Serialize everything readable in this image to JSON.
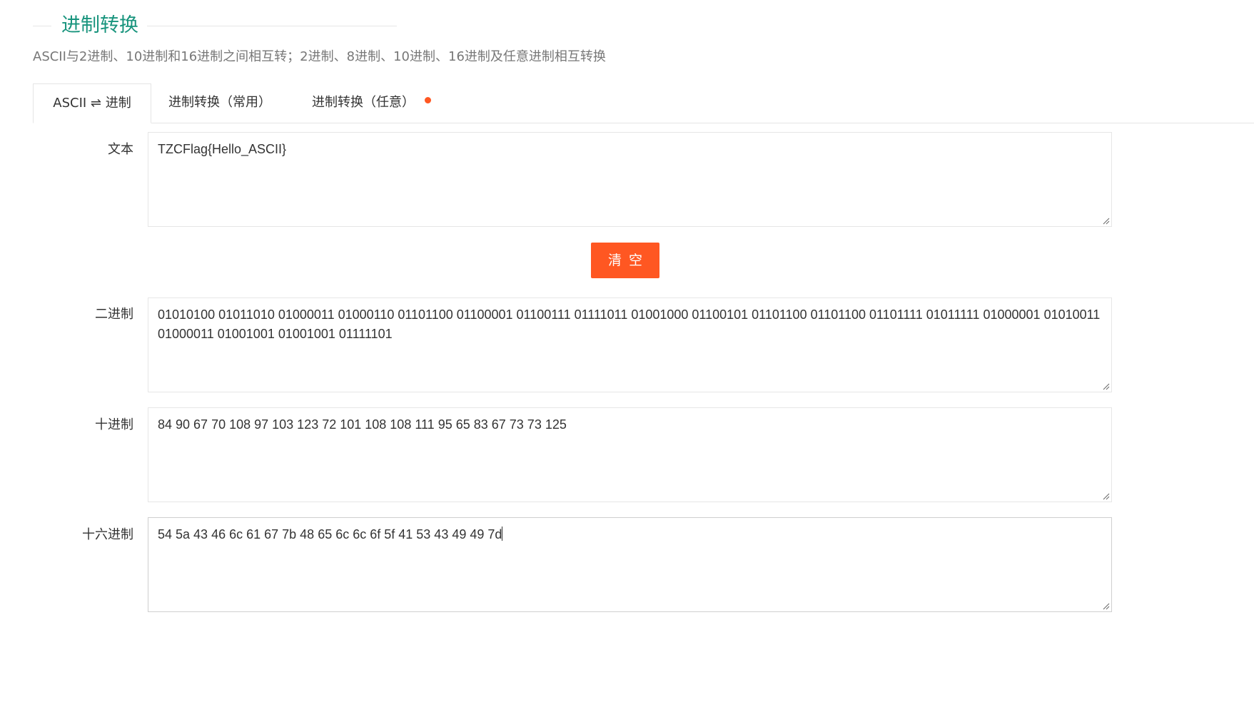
{
  "header": {
    "title": "进制转换",
    "subtitle": "ASCII与2进制、10进制和16进制之间相互转；2进制、8进制、10进制、16进制及任意进制相互转换"
  },
  "tabs": [
    {
      "label": "ASCII ⇌ 进制",
      "active": true
    },
    {
      "label": "进制转换（常用）",
      "active": false
    },
    {
      "label": "进制转换（任意）",
      "active": false,
      "badge": "red-dot"
    }
  ],
  "form": {
    "text": {
      "label": "文本",
      "value": "TZCFlag{Hello_ASCII}"
    },
    "clear_button": "清空",
    "binary": {
      "label": "二进制",
      "value": "01010100 01011010 01000011 01000110 01101100 01100001 01100111 01111011 01001000 01100101 01101100 01101100 01101111 01011111 01000001 01010011 01000011 01001001 01001001 01111101"
    },
    "decimal": {
      "label": "十进制",
      "value": "84 90 67 70 108 97 103 123 72 101 108 108 111 95 65 83 67 73 73 125"
    },
    "hex": {
      "label": "十六进制",
      "value": "54 5a 43 46 6c 61 67 7b 48 65 6c 6c 6f 5f 41 53 43 49 49 7d"
    }
  },
  "colors": {
    "accent_green": "#18947d",
    "button_orange": "#ff5722",
    "badge_dot": "#ff5722"
  }
}
